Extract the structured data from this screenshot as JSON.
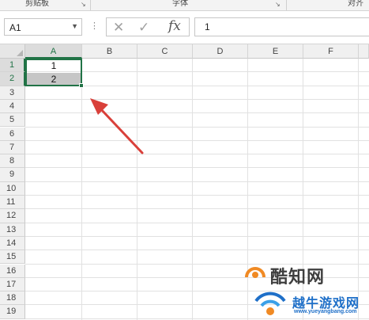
{
  "ribbon": {
    "groups": [
      {
        "label": "剪贴板"
      },
      {
        "label": "字体"
      },
      {
        "label": "对齐"
      }
    ]
  },
  "formula_bar": {
    "name_box": "A1",
    "formula": "1",
    "fx_label": "fx"
  },
  "sheet": {
    "columns": [
      "A",
      "B",
      "C",
      "D",
      "E",
      "F"
    ],
    "rows": [
      "1",
      "2",
      "3",
      "4",
      "5",
      "6",
      "7",
      "8",
      "9",
      "10",
      "11",
      "12",
      "13",
      "14",
      "15",
      "16",
      "17",
      "18",
      "19"
    ],
    "cells": {
      "A1": "1",
      "A2": "2"
    },
    "active_column": "A",
    "selection": "A1:A2"
  },
  "colors": {
    "excel_green": "#217346",
    "annotation_red": "#d9403a"
  },
  "watermark": {
    "text1": "酷知网",
    "text2": "越牛游戏网",
    "text3": "www.yueyangbang.com"
  }
}
